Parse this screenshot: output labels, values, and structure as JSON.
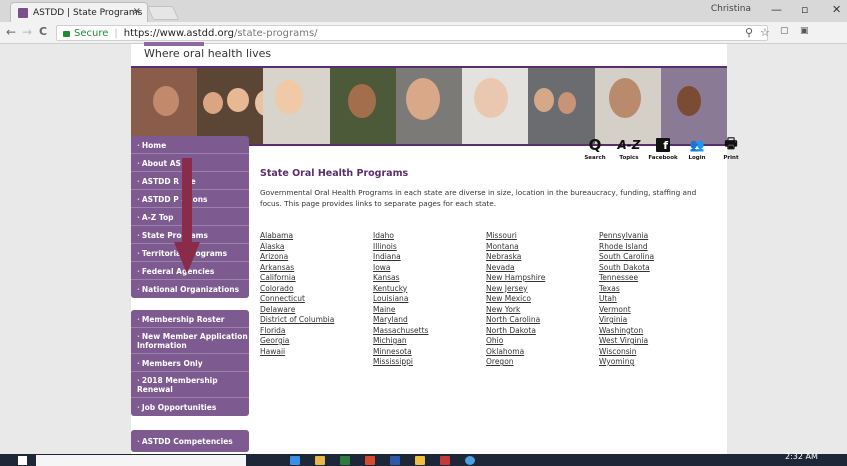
{
  "browser": {
    "tab_title": "ASTDD | State Programs",
    "tab_close": "×",
    "user_name": "Christina",
    "window_controls": [
      "—",
      "▫",
      "✕"
    ],
    "nav_back": "←",
    "nav_forward": "→",
    "nav_reload": "C",
    "secure_label": "Secure",
    "url_host": "https://www.astdd.org",
    "url_path": "/state-programs/",
    "toolbar_icons": [
      "zoom-icon",
      "star-icon",
      "extension-icon",
      "extension-icon-2"
    ]
  },
  "site": {
    "tagline": "Where oral health lives",
    "accent_color": "#7d5a8f"
  },
  "sidebar": {
    "group1": [
      "Home",
      "About AS",
      "ASTDD R     ure",
      "ASTDD P      ations",
      "A-Z Top",
      "State Programs",
      "Territorial Programs",
      "Federal Agencies",
      "National Organizations"
    ],
    "group2": [
      "Membership Roster",
      "New Member Application Information",
      "Members Only",
      "2018 Membership Renewal",
      "Job Opportunities"
    ],
    "group3": [
      "ASTDD Competencies"
    ]
  },
  "utility_icons": [
    {
      "icon": "search-icon",
      "glyph": "Q",
      "label": "Search"
    },
    {
      "icon": "a-z-icon",
      "glyph": "A-Z",
      "label": "Topics"
    },
    {
      "icon": "facebook-icon",
      "glyph": "f",
      "label": "Facebook"
    },
    {
      "icon": "login-icon",
      "glyph": "👥",
      "label": "Login"
    },
    {
      "icon": "print-icon",
      "glyph": "🖶",
      "label": "Print"
    }
  ],
  "main": {
    "heading": "State Oral Health Programs",
    "intro": "Governmental Oral Health Programs in each state are diverse in size, location in the bureaucracy, funding, staffing and focus. This page provides links to separate pages for each state.",
    "state_columns": [
      [
        "Alabama",
        "Alaska",
        "Arizona",
        "Arkansas",
        "California",
        "Colorado",
        "Connecticut",
        "Delaware",
        "District of Columbia",
        "Florida",
        "Georgia",
        "Hawaii"
      ],
      [
        "Idaho",
        "Illinois",
        "Indiana",
        "Iowa",
        "Kansas",
        "Kentucky",
        "Louisiana",
        "Maine",
        "Maryland",
        "Massachusetts",
        "Michigan",
        "Minnesota",
        "Mississippi"
      ],
      [
        "Missouri",
        "Montana",
        "Nebraska",
        "Nevada",
        "New Hampshire",
        "New Jersey",
        "New Mexico",
        "New York",
        "North Carolina",
        "North Dakota",
        "Ohio",
        "Oklahoma",
        "Oregon"
      ],
      [
        "Pennsylvania",
        "Rhode Island",
        "South Carolina",
        "South Dakota",
        "Tennessee",
        "Texas",
        "Utah",
        "Vermont",
        "Virginia",
        "Washington",
        "West Virginia",
        "Wisconsin",
        "Wyoming"
      ]
    ]
  },
  "taskbar": {
    "time": "2:32 AM"
  },
  "annotation": {
    "arrow_color": "#8b2b4a"
  }
}
